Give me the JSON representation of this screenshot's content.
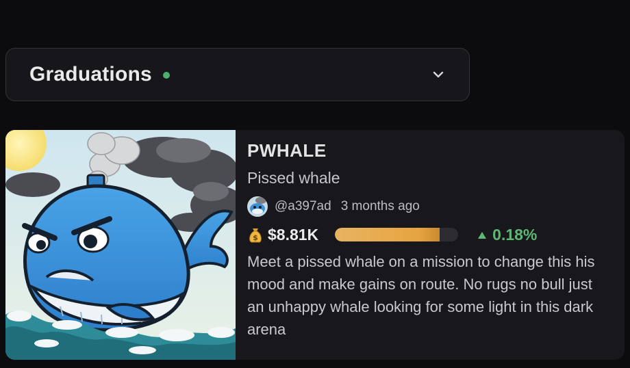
{
  "dropdown": {
    "label": "Graduations",
    "status_color": "#4caf6e",
    "icon": "chevron-down-icon"
  },
  "token": {
    "ticker": "PWHALE",
    "name": "Pissed whale",
    "creator": "@a397ad",
    "age": "3 months ago",
    "market_cap": "$8.81K",
    "market_cap_icon": "money-bag-icon",
    "bonding_progress": 0.85,
    "change_icon": "triangle-up-icon",
    "change": "0.18%",
    "change_color": "#5db876",
    "description": "Meet a pissed whale on a mission to change this his mood and make gains on route. No rugs no bull just an unhappy whale looking for some light in this dark arena"
  },
  "colors": {
    "background": "#0c0c0f",
    "card": "#18181c",
    "accent_progress": "#e7a440"
  }
}
